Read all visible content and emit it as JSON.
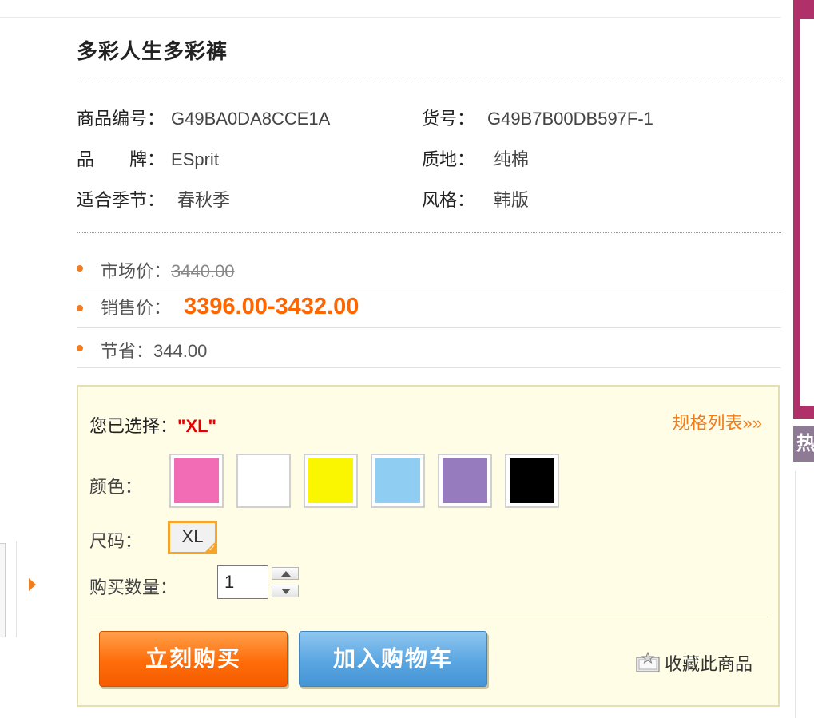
{
  "product": {
    "title": "多彩人生多彩裤",
    "attributes_left": [
      {
        "label": "商品编号：",
        "value": "G49BA0DA8CCE1A"
      },
      {
        "label": "品　　牌：",
        "value": "ESprit"
      },
      {
        "label": "适合季节：",
        "value": "春秋季"
      }
    ],
    "attributes_right": [
      {
        "label": "货号：",
        "value": "G49B7B00DB597F-1"
      },
      {
        "label": "质地：",
        "value": "纯棉"
      },
      {
        "label": "风格：",
        "value": "韩版"
      }
    ]
  },
  "prices": {
    "market_label": "市场价：",
    "market_value": "3440.00",
    "sale_label": "销售价：",
    "sale_value": "3396.00-3432.00",
    "save_label": "节省：",
    "save_value": "344.00"
  },
  "options": {
    "selected_label": "您已选择：",
    "selected_value": "\"XL\"",
    "spec_link": "规格列表»»",
    "color_label": "颜色：",
    "colors": [
      "#f26bb5",
      "#ffffff",
      "#faf500",
      "#8fcdf2",
      "#967bbf",
      "#000000"
    ],
    "size_label": "尺码：",
    "size_value": "XL",
    "qty_label": "购买数量：",
    "qty_value": "1"
  },
  "actions": {
    "buy_now": "立刻购买",
    "add_to_cart": "加入购物车",
    "favorite": "收藏此商品"
  },
  "side": {
    "tab_label": "热"
  },
  "colors": {
    "accent": "#ff6600",
    "selected_border": "#f7a42a",
    "option_bg": "#fffde6",
    "side_banner": "#b0316a"
  }
}
